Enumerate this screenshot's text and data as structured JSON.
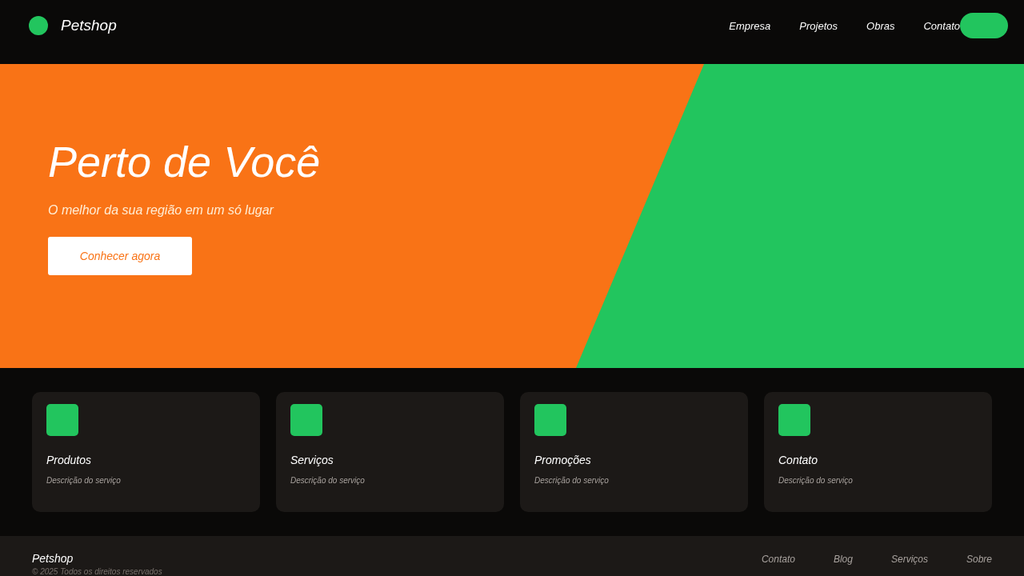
{
  "header": {
    "brand": "Petshop",
    "nav": [
      "Empresa",
      "Projetos",
      "Obras",
      "Contato"
    ]
  },
  "hero": {
    "title": "Perto de Você",
    "subtitle": "O melhor da sua região em um só lugar",
    "button": "Conhecer agora"
  },
  "cards": [
    {
      "title": "Produtos",
      "description": "Descrição do serviço"
    },
    {
      "title": "Serviços",
      "description": "Descrição do serviço"
    },
    {
      "title": "Promoções",
      "description": "Descrição do serviço"
    },
    {
      "title": "Contato",
      "description": "Descrição do serviço"
    }
  ],
  "footer": {
    "brand": "Petshop",
    "copyright": "© 2025 Todos os direitos reservados",
    "links": [
      "Contato",
      "Blog",
      "Serviços",
      "Sobre"
    ]
  }
}
